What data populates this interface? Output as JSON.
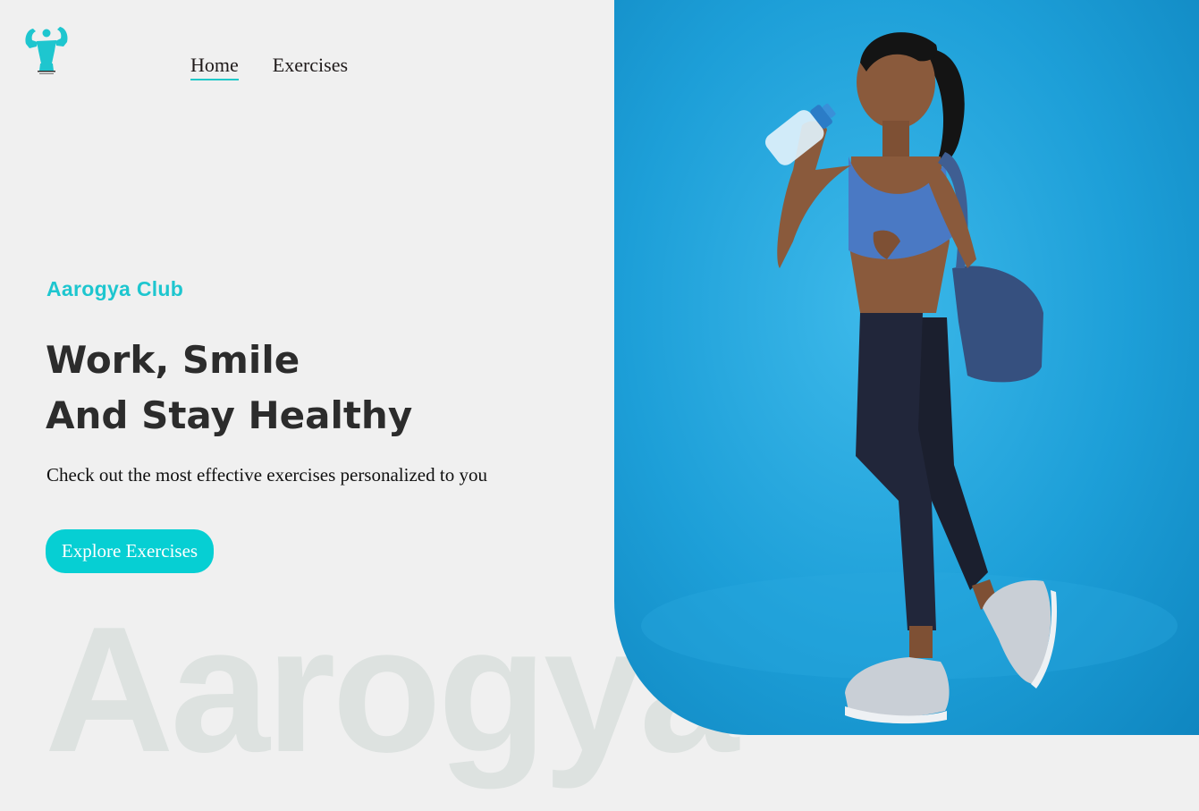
{
  "logo": {
    "icon": "flexing-bodybuilder-icon",
    "color": "#1ec6cf"
  },
  "nav": {
    "items": [
      {
        "label": "Home",
        "active": true
      },
      {
        "label": "Exercises",
        "active": false
      }
    ],
    "active_underline_color": "#1fc8c8"
  },
  "hero": {
    "subtitle": "Aarogya Club",
    "headline_line1": "Work, Smile",
    "headline_line2": "And Stay Healthy",
    "tagline": "Check out the most effective exercises personalized to you",
    "cta_label": "Explore Exercises",
    "watermark": "Aarogya"
  },
  "colors": {
    "accent": "#1ec6cf",
    "button": "#06cfd3",
    "page_background": "#f0f0f0",
    "watermark": "#dde2e0",
    "image_background": "#1d9fd8"
  }
}
